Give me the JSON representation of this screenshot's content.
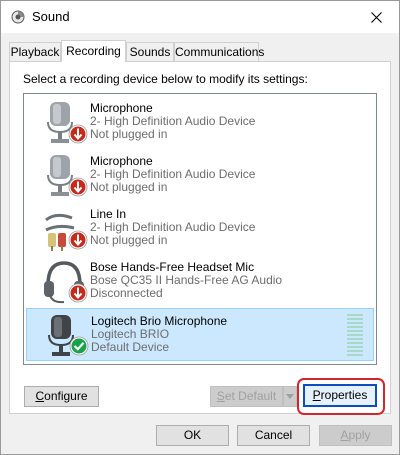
{
  "window": {
    "title": "Sound",
    "close_glyph": "✕"
  },
  "tabs": [
    {
      "label": "Playback",
      "active": false
    },
    {
      "label": "Recording",
      "active": true
    },
    {
      "label": "Sounds",
      "active": false
    },
    {
      "label": "Communications",
      "active": false
    }
  ],
  "instruction": "Select a recording device below to modify its settings:",
  "devices": [
    {
      "name": "Microphone",
      "detail": "2- High Definition Audio Device",
      "status": "Not plugged in",
      "icon": "microphone-icon",
      "badge": "not-plugged-in-badge",
      "selected": false
    },
    {
      "name": "Microphone",
      "detail": "2- High Definition Audio Device",
      "status": "Not plugged in",
      "icon": "microphone-icon",
      "badge": "not-plugged-in-badge",
      "selected": false
    },
    {
      "name": "Line In",
      "detail": "2- High Definition Audio Device",
      "status": "Not plugged in",
      "icon": "line-in-cable-icon",
      "badge": "not-plugged-in-badge",
      "selected": false
    },
    {
      "name": "Bose Hands-Free Headset Mic",
      "detail": "Bose QC35 II Hands-Free AG Audio",
      "status": "Disconnected",
      "icon": "headset-icon",
      "badge": "disconnected-badge",
      "selected": false
    },
    {
      "name": "Logitech Brio Microphone",
      "detail": "Logitech BRIO",
      "status": "Default Device",
      "icon": "microphone-icon",
      "badge": "default-device-check-badge",
      "selected": true
    }
  ],
  "buttons": {
    "configure": {
      "before": "",
      "mnemonic": "C",
      "after": "onfigure"
    },
    "set_default": {
      "before": "",
      "mnemonic": "S",
      "after": "et Default",
      "enabled": false
    },
    "properties": {
      "before": "",
      "mnemonic": "P",
      "after": "roperties"
    },
    "ok": "OK",
    "cancel": "Cancel",
    "apply": {
      "before": "",
      "mnemonic": "A",
      "after": "pply",
      "enabled": false
    }
  },
  "colors": {
    "accent_selection": "#cce8ff",
    "badge_red": "#c42b1c",
    "badge_green": "#16a34a",
    "highlight_ring": "#d0262e"
  }
}
